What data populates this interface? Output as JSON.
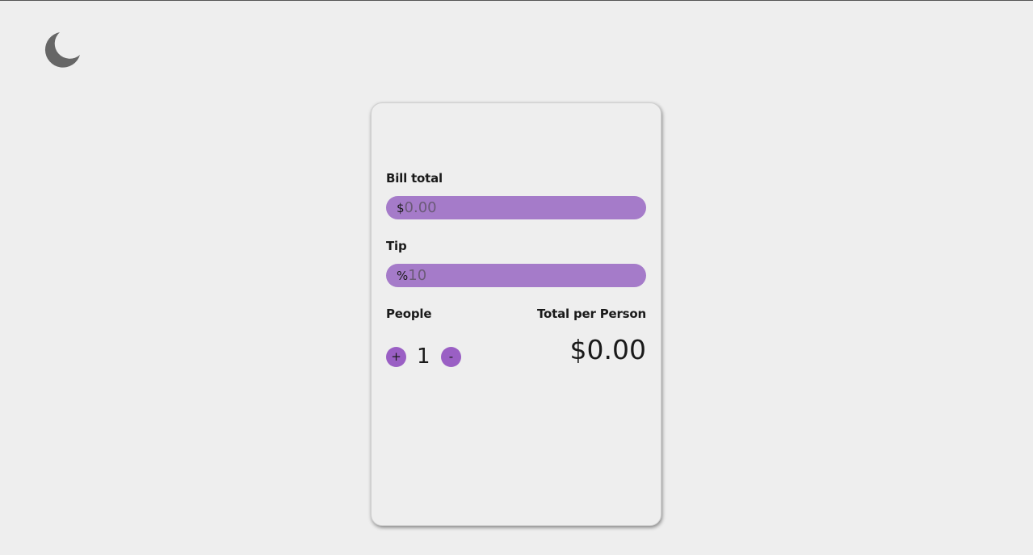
{
  "theme_toggle": {
    "icon": "moon-icon",
    "color": "#666666"
  },
  "accent_color": "#a57bc9",
  "bill": {
    "label": "Bill total",
    "prefix": "$",
    "placeholder": "0.00"
  },
  "tip": {
    "label": "Tip",
    "prefix": "%",
    "placeholder": "10"
  },
  "people": {
    "label": "People",
    "increment_label": "+",
    "decrement_label": "-",
    "count": "1"
  },
  "result": {
    "label": "Total per Person",
    "value": "$0.00"
  }
}
